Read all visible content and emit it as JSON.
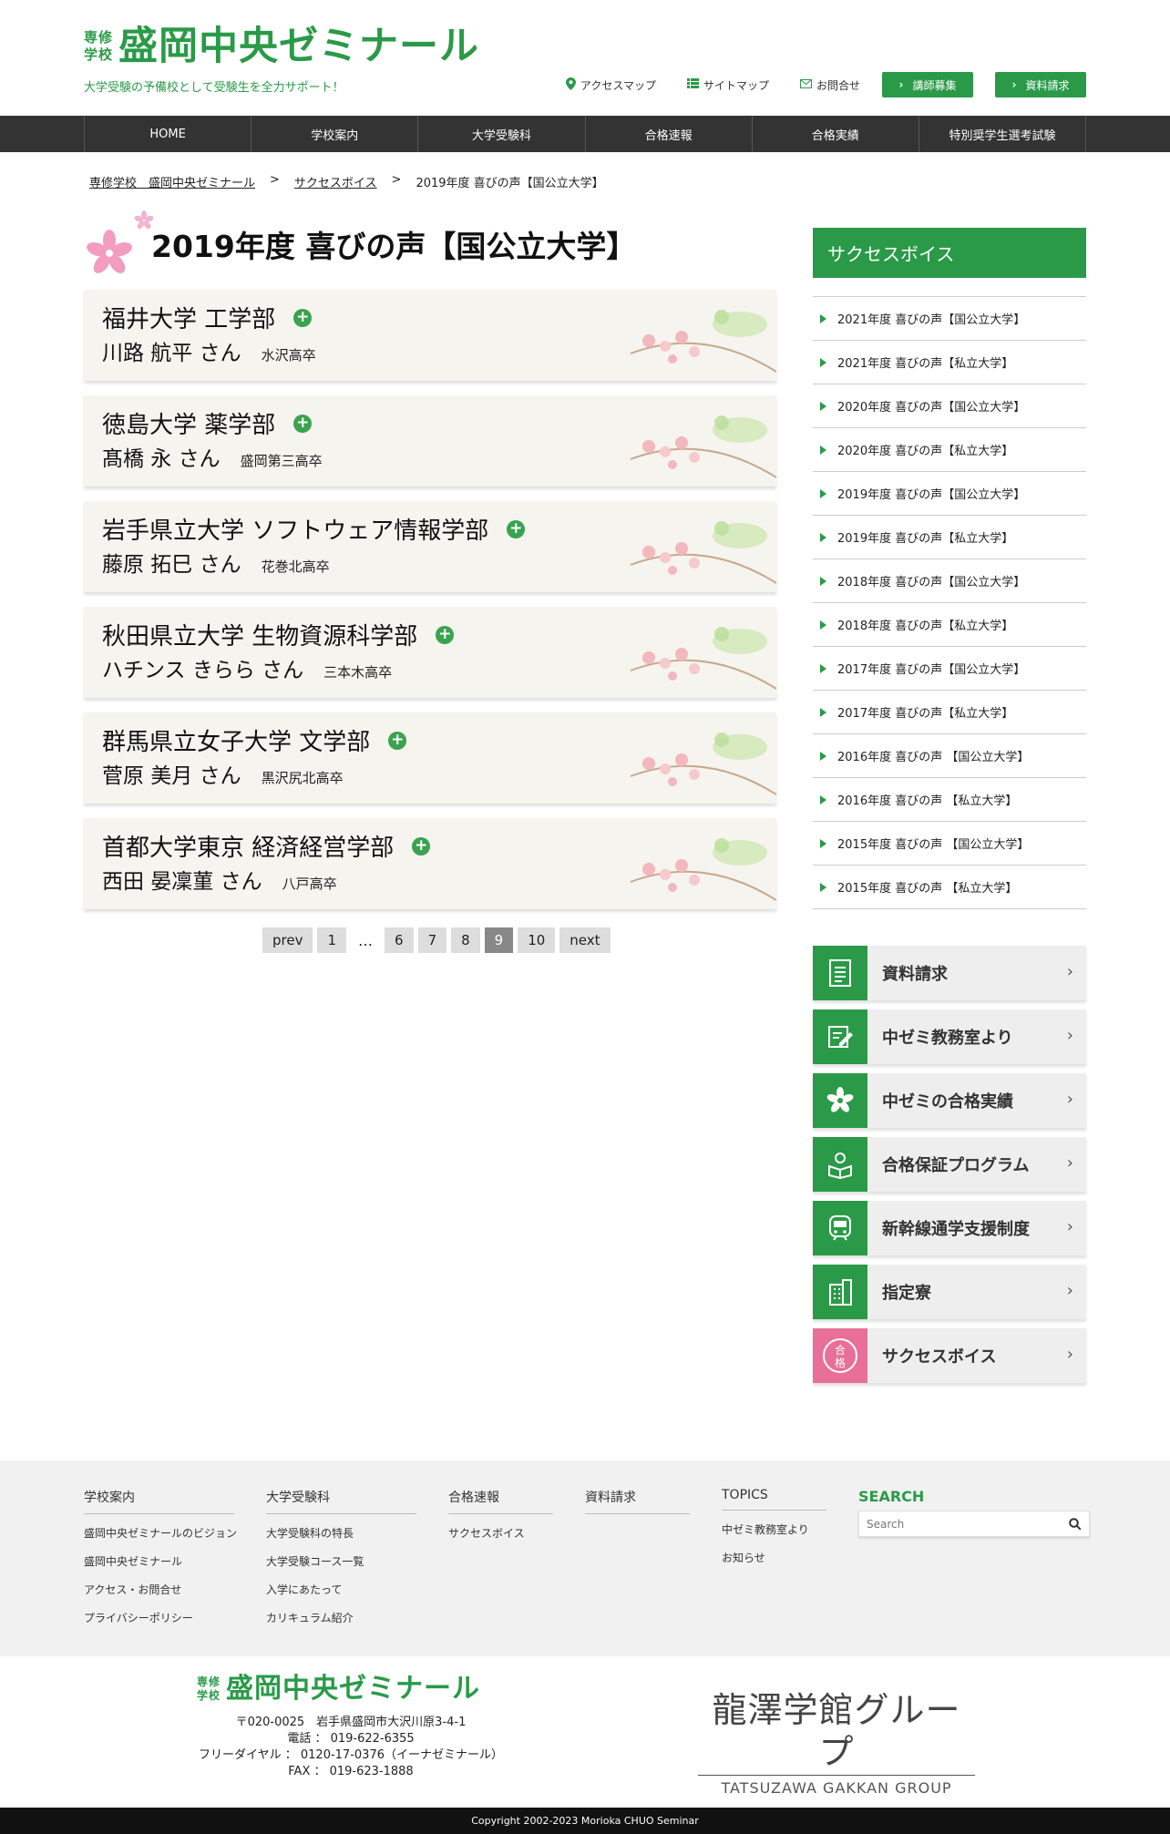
{
  "header": {
    "logo_small_1": "専修",
    "logo_small_2": "学校",
    "logo_main": "盛岡中央ゼミナール",
    "tagline": "大学受験の予備校として受験生を全力サポート！",
    "toplinks": {
      "access": "アクセスマップ",
      "sitemap": "サイトマップ",
      "contact": "お問合せ",
      "recruit": "講師募集",
      "brochure": "資料請求"
    }
  },
  "nav": [
    "HOME",
    "学校案内",
    "大学受験科",
    "合格速報",
    "合格実績",
    "特別奨学生選考試験"
  ],
  "breadcrumb": {
    "home": "専修学校　盛岡中央ゼミナール",
    "sep": ">",
    "parent": "サクセスボイス",
    "current": "2019年度 喜びの声【国公立大学】"
  },
  "page_title": "2019年度 喜びの声【国公立大学】",
  "voices": [
    {
      "univ": "福井大学 工学部",
      "name": "川路 航平 さん",
      "school": "水沢高卒"
    },
    {
      "univ": "徳島大学 薬学部",
      "name": "髙橋 永 さん",
      "school": "盛岡第三高卒"
    },
    {
      "univ": "岩手県立大学 ソフトウェア情報学部",
      "name": "藤原 拓巳 さん",
      "school": "花巻北高卒"
    },
    {
      "univ": "秋田県立大学 生物資源科学部",
      "name": "ハチンス きらら さん",
      "school": "三本木高卒"
    },
    {
      "univ": "群馬県立女子大学 文学部",
      "name": "菅原 美月 さん",
      "school": "黒沢尻北高卒"
    },
    {
      "univ": "首都大学東京 経済経営学部",
      "name": "西田 晏凜菫 さん",
      "school": "八戸高卒"
    }
  ],
  "pagination": {
    "prev": "prev",
    "p1": "1",
    "dots": "…",
    "p6": "6",
    "p7": "7",
    "p8": "8",
    "p9": "9",
    "p10": "10",
    "next": "next",
    "current": "9"
  },
  "sidebar": {
    "title": "サクセスボイス",
    "items": [
      "2021年度 喜びの声【国公立大学】",
      "2021年度 喜びの声【私立大学】",
      "2020年度 喜びの声【国公立大学】",
      "2020年度 喜びの声【私立大学】",
      "2019年度 喜びの声【国公立大学】",
      "2019年度 喜びの声【私立大学】",
      "2018年度 喜びの声【国公立大学】",
      "2018年度 喜びの声【私立大学】",
      "2017年度 喜びの声【国公立大学】",
      "2017年度 喜びの声【私立大学】",
      "2016年度 喜びの声 【国公立大学】",
      "2016年度 喜びの声 【私立大学】",
      "2015年度 喜びの声 【国公立大学】",
      "2015年度 喜びの声 【私立大学】"
    ],
    "banners": [
      {
        "label": "資料請求",
        "icon": "document-icon"
      },
      {
        "label": "中ゼミ教務室より",
        "icon": "edit-note-icon"
      },
      {
        "label": "中ゼミの合格実績",
        "icon": "sakura-icon"
      },
      {
        "label": "合格保証プログラム",
        "icon": "student-reading-icon"
      },
      {
        "label": "新幹線通学支援制度",
        "icon": "train-icon"
      },
      {
        "label": "指定寮",
        "icon": "building-icon"
      },
      {
        "label": "サクセスボイス",
        "icon": "pass-stamp-icon"
      }
    ],
    "stamp_text_1": "合",
    "stamp_text_2": "格"
  },
  "footer": {
    "columns": [
      {
        "title": "学校案内",
        "links": [
          "盛岡中央ゼミナールのビジョン",
          "盛岡中央ゼミナール",
          "アクセス・お問合せ",
          "プライバシーポリシー"
        ]
      },
      {
        "title": "大学受験科",
        "links": [
          "大学受験科の特長",
          "大学受験コース一覧",
          "入学にあたって",
          "カリキュラム紹介"
        ]
      },
      {
        "title": "合格速報",
        "links": [
          "サクセスボイス"
        ]
      },
      {
        "title": "資料請求",
        "links": []
      },
      {
        "title": "TOPICS",
        "links": [
          "中ゼミ教務室より",
          "お知らせ"
        ]
      }
    ],
    "search_title": "SEARCH",
    "search_placeholder": "Search",
    "logo_small_1": "専修",
    "logo_small_2": "学校",
    "logo_main": "盛岡中央ゼミナール",
    "address": "〒020-0025　岩手県盛岡市大沢川原3-4-1",
    "tel": "電話 ： 019-622-6355",
    "freedial": "フリーダイヤル ： 0120-17-0376（イーナゼミナール）",
    "fax": "FAX ： 019-623-1888",
    "group_name": "龍澤学館グループ",
    "group_en": "TATSUZAWA GAKKAN GROUP",
    "copyright": "Copyright 2002-2023 Morioka CHUO Seminar"
  },
  "colors": {
    "brand_green": "#2a9a48",
    "pink": "#e86f97",
    "nav_bg": "#333333"
  }
}
